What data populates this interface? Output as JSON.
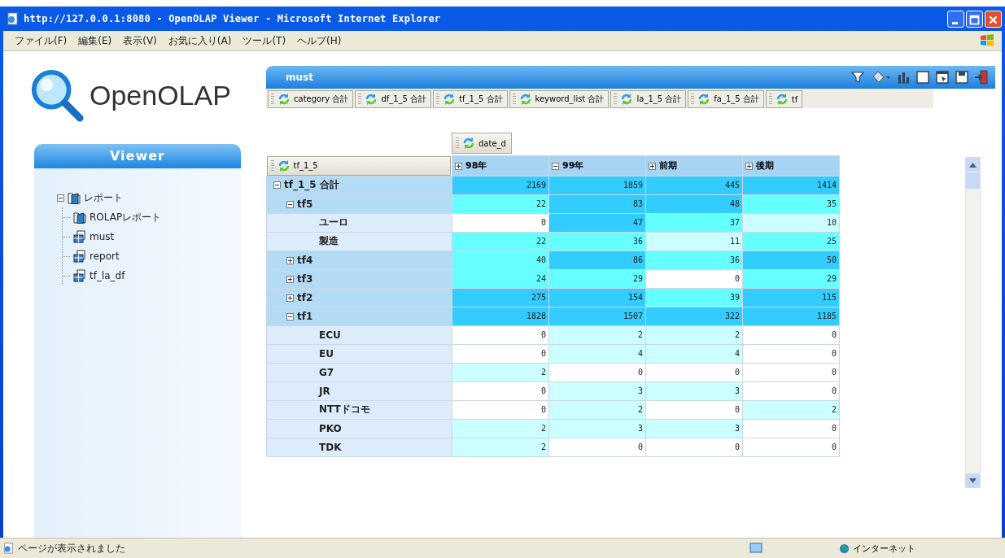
{
  "window": {
    "title": "http://127.0.0.1:8080 - OpenOLAP Viewer - Microsoft Internet Explorer"
  },
  "menu_bar": [
    "ファイル(F)",
    "編集(E)",
    "表示(V)",
    "お気に入り(A)",
    "ツール(T)",
    "ヘルプ(H)"
  ],
  "logo": {
    "text": "OpenOLAP"
  },
  "sidebar": {
    "title": "Viewer",
    "tree": [
      {
        "label": "レポート",
        "kind": "folder",
        "expanded": true,
        "children": [
          {
            "label": "ROLAPレポート",
            "kind": "folder"
          },
          {
            "label": "must",
            "kind": "report"
          },
          {
            "label": "report",
            "kind": "report"
          },
          {
            "label": "tf_la_df",
            "kind": "report"
          }
        ]
      }
    ]
  },
  "report": {
    "title": "must",
    "dimension_tabs": [
      "category 合計",
      "df_1_5 合計",
      "tf_1_5 合計",
      "keyword_list 合計",
      "la_1_5 合計",
      "fa_1_5 合計",
      "tf"
    ],
    "column_dimension": "date_d",
    "row_dimension": "tf_1_5",
    "columns": [
      {
        "label": "98年",
        "expanded": false
      },
      {
        "label": "99年",
        "expanded": true
      },
      {
        "label": "前期",
        "expanded": false
      },
      {
        "label": "後期",
        "expanded": false
      }
    ],
    "rows": [
      {
        "label": "tf_1_5 合計",
        "expanded": true,
        "cells": [
          {
            "value": "2169",
            "color": "#33ccff"
          },
          {
            "value": "1859",
            "color": "#33ccff"
          },
          {
            "value": "445",
            "color": "#33ccff"
          },
          {
            "value": "1414",
            "color": "#33ccff"
          }
        ],
        "children": [
          {
            "label": "tf5",
            "expanded": true,
            "cells": [
              {
                "value": "22",
                "color": "#66ffff"
              },
              {
                "value": "83",
                "color": "#33ccff"
              },
              {
                "value": "48",
                "color": "#33ccff"
              },
              {
                "value": "35",
                "color": "#66ffff"
              }
            ],
            "children": [
              {
                "label": "ユーロ",
                "cells": [
                  {
                    "value": "0",
                    "color": "#ffffff"
                  },
                  {
                    "value": "47",
                    "color": "#33ccff"
                  },
                  {
                    "value": "37",
                    "color": "#66ffff"
                  },
                  {
                    "value": "10",
                    "color": "#ccffff"
                  }
                ]
              },
              {
                "label": "製造",
                "cells": [
                  {
                    "value": "22",
                    "color": "#66ffff"
                  },
                  {
                    "value": "36",
                    "color": "#66ffff"
                  },
                  {
                    "value": "11",
                    "color": "#ccffff"
                  },
                  {
                    "value": "25",
                    "color": "#66ffff"
                  }
                ]
              }
            ]
          },
          {
            "label": "tf4",
            "expanded": false,
            "cells": [
              {
                "value": "40",
                "color": "#66ffff"
              },
              {
                "value": "86",
                "color": "#33ccff"
              },
              {
                "value": "36",
                "color": "#66ffff"
              },
              {
                "value": "50",
                "color": "#33ccff"
              }
            ]
          },
          {
            "label": "tf3",
            "expanded": false,
            "cells": [
              {
                "value": "24",
                "color": "#66ffff"
              },
              {
                "value": "29",
                "color": "#66ffff"
              },
              {
                "value": "0",
                "color": "#ffffff"
              },
              {
                "value": "29",
                "color": "#66ffff"
              }
            ]
          },
          {
            "label": "tf2",
            "expanded": false,
            "cells": [
              {
                "value": "275",
                "color": "#33ccff"
              },
              {
                "value": "154",
                "color": "#33ccff"
              },
              {
                "value": "39",
                "color": "#66ffff"
              },
              {
                "value": "115",
                "color": "#33ccff"
              }
            ]
          },
          {
            "label": "tf1",
            "expanded": true,
            "cells": [
              {
                "value": "1828",
                "color": "#33ccff"
              },
              {
                "value": "1507",
                "color": "#33ccff"
              },
              {
                "value": "322",
                "color": "#33ccff"
              },
              {
                "value": "1185",
                "color": "#33ccff"
              }
            ],
            "children": [
              {
                "label": "ECU",
                "cells": [
                  {
                    "value": "0",
                    "color": "#ffffff"
                  },
                  {
                    "value": "2",
                    "color": "#ccffff"
                  },
                  {
                    "value": "2",
                    "color": "#ccffff"
                  },
                  {
                    "value": "0",
                    "color": "#ffffff"
                  }
                ]
              },
              {
                "label": "EU",
                "cells": [
                  {
                    "value": "0",
                    "color": "#ffffff"
                  },
                  {
                    "value": "4",
                    "color": "#ccffff"
                  },
                  {
                    "value": "4",
                    "color": "#ccffff"
                  },
                  {
                    "value": "0",
                    "color": "#ffffff"
                  }
                ]
              },
              {
                "label": "G7",
                "cells": [
                  {
                    "value": "2",
                    "color": "#ccffff"
                  },
                  {
                    "value": "0",
                    "color": "#ffffff"
                  },
                  {
                    "value": "0",
                    "color": "#ffffff"
                  },
                  {
                    "value": "0",
                    "color": "#ffffff"
                  }
                ]
              },
              {
                "label": "JR",
                "cells": [
                  {
                    "value": "0",
                    "color": "#ffffff"
                  },
                  {
                    "value": "3",
                    "color": "#ccffff"
                  },
                  {
                    "value": "3",
                    "color": "#ccffff"
                  },
                  {
                    "value": "0",
                    "color": "#ffffff"
                  }
                ]
              },
              {
                "label": "NTTドコモ",
                "cells": [
                  {
                    "value": "0",
                    "color": "#ffffff"
                  },
                  {
                    "value": "2",
                    "color": "#ccffff"
                  },
                  {
                    "value": "0",
                    "color": "#ffffff"
                  },
                  {
                    "value": "2",
                    "color": "#ccffff"
                  }
                ]
              },
              {
                "label": "PKO",
                "cells": [
                  {
                    "value": "2",
                    "color": "#ccffff"
                  },
                  {
                    "value": "3",
                    "color": "#ccffff"
                  },
                  {
                    "value": "3",
                    "color": "#ccffff"
                  },
                  {
                    "value": "0",
                    "color": "#ffffff"
                  }
                ]
              },
              {
                "label": "TDK",
                "cells": [
                  {
                    "value": "2",
                    "color": "#ccffff"
                  },
                  {
                    "value": "0",
                    "color": "#ffffff"
                  },
                  {
                    "value": "0",
                    "color": "#ffffff"
                  },
                  {
                    "value": "0",
                    "color": "#ffffff"
                  }
                ]
              }
            ]
          }
        ]
      }
    ]
  },
  "status_bar": {
    "message": "ページが表示されました",
    "zone": "インターネット"
  }
}
